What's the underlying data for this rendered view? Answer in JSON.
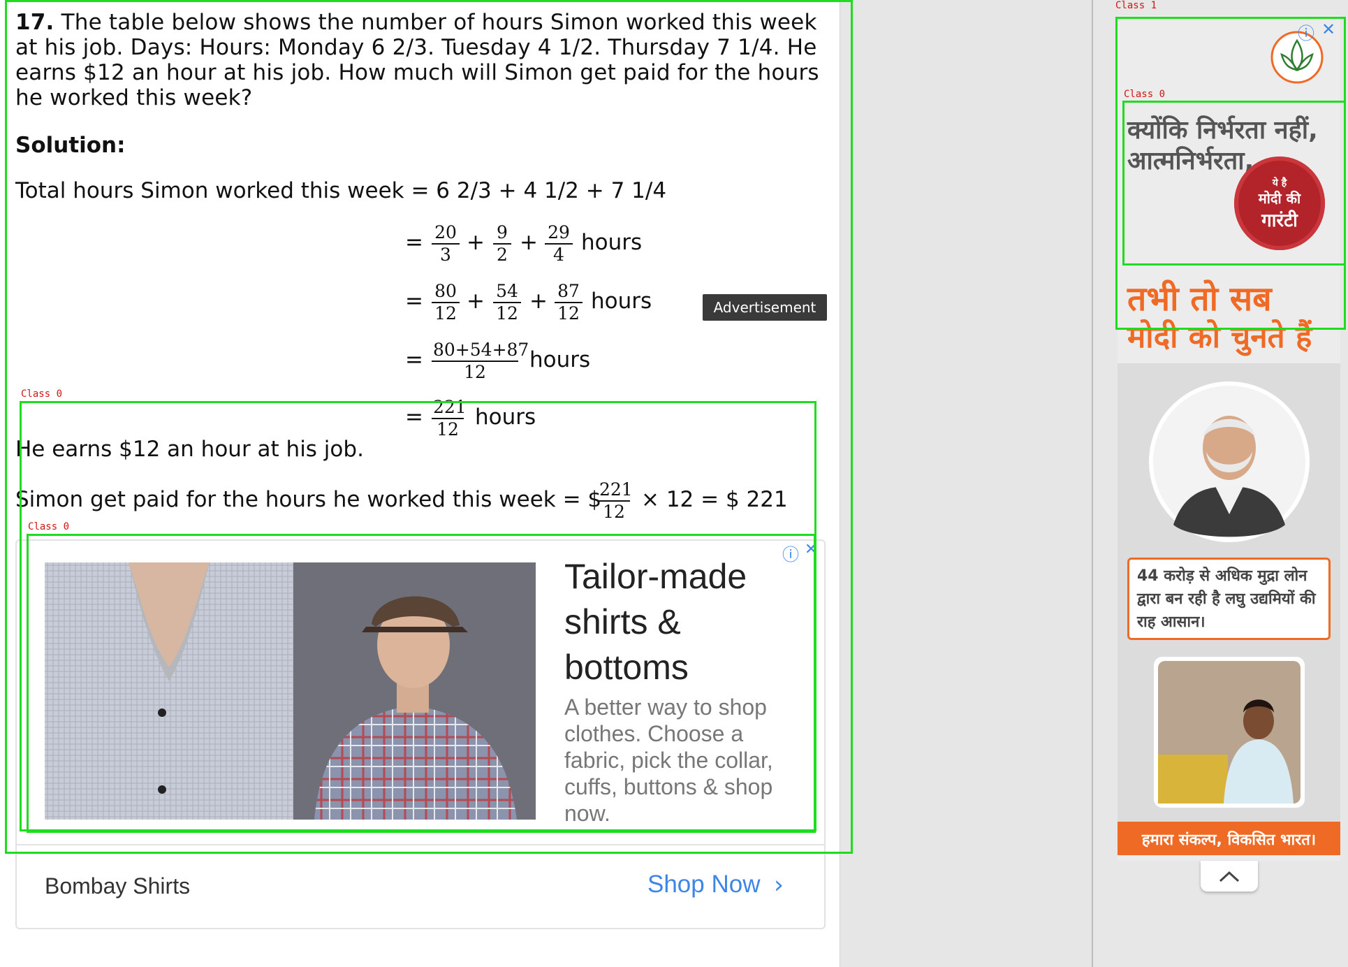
{
  "question": {
    "number": "17.",
    "text": "The table below shows the number of hours Simon worked this week at his job. Days: Hours: Monday 6 2/3. Tuesday 4 1/2. Thursday 7 1/4. He earns $12 an hour at his job. How much will Simon get paid for the hours he worked this week?"
  },
  "solution": {
    "heading": "Solution:",
    "total_line": "Total hours Simon worked this week = 6 2/3 + 4 1/2 + 7 1/4",
    "eq": "=",
    "plus": "+",
    "hours": "hours",
    "step1": {
      "a": [
        "20",
        "3"
      ],
      "b": [
        "9",
        "2"
      ],
      "c": [
        "29",
        "4"
      ]
    },
    "step2": {
      "a": [
        "80",
        "12"
      ],
      "b": [
        "54",
        "12"
      ],
      "c": [
        "87",
        "12"
      ]
    },
    "step3": [
      "80+54+87",
      "12"
    ],
    "step4": [
      "221",
      "12"
    ],
    "rate_line": "He earns $12 an hour at his job.",
    "paid_prefix": "Simon get paid for the hours he worked this week = $",
    "paid_frac": [
      "221",
      "12"
    ],
    "paid_suffix": "× 12 = $ 221"
  },
  "advertisement_badge": "Advertisement",
  "detections": {
    "class0": "Class  0",
    "class1": "Class  1"
  },
  "shirt_ad": {
    "headline": "Tailor-made shirts & bottoms",
    "description": "A better way to shop clothes. Choose a fabric, pick the collar, cuffs, buttons & shop now.",
    "advertiser": "Bombay Shirts",
    "cta": "Shop Now",
    "cta_color": "#3d86e8"
  },
  "side_ad": {
    "line1": "क्योंकि निर्भरता नहीं,",
    "line2": "आत्मनिर्भरता,",
    "seal_line1": "ये है",
    "seal_line2": "मोदी की",
    "seal_line3": "गारंटी",
    "slogan1": "तभी तो सब",
    "slogan2": "मोदी को चुनते हैं",
    "info_text": "44 करोड़ से अधिक मुद्रा लोन द्वारा बन रही है लघु उद्यमियों की राह आसान।",
    "footer": "हमारा संकल्प, विकसित भारत।",
    "accent_color": "#ef6a25"
  },
  "ad_icons": {
    "info": "ⓘ",
    "close": "✕",
    "chevron": "›"
  }
}
